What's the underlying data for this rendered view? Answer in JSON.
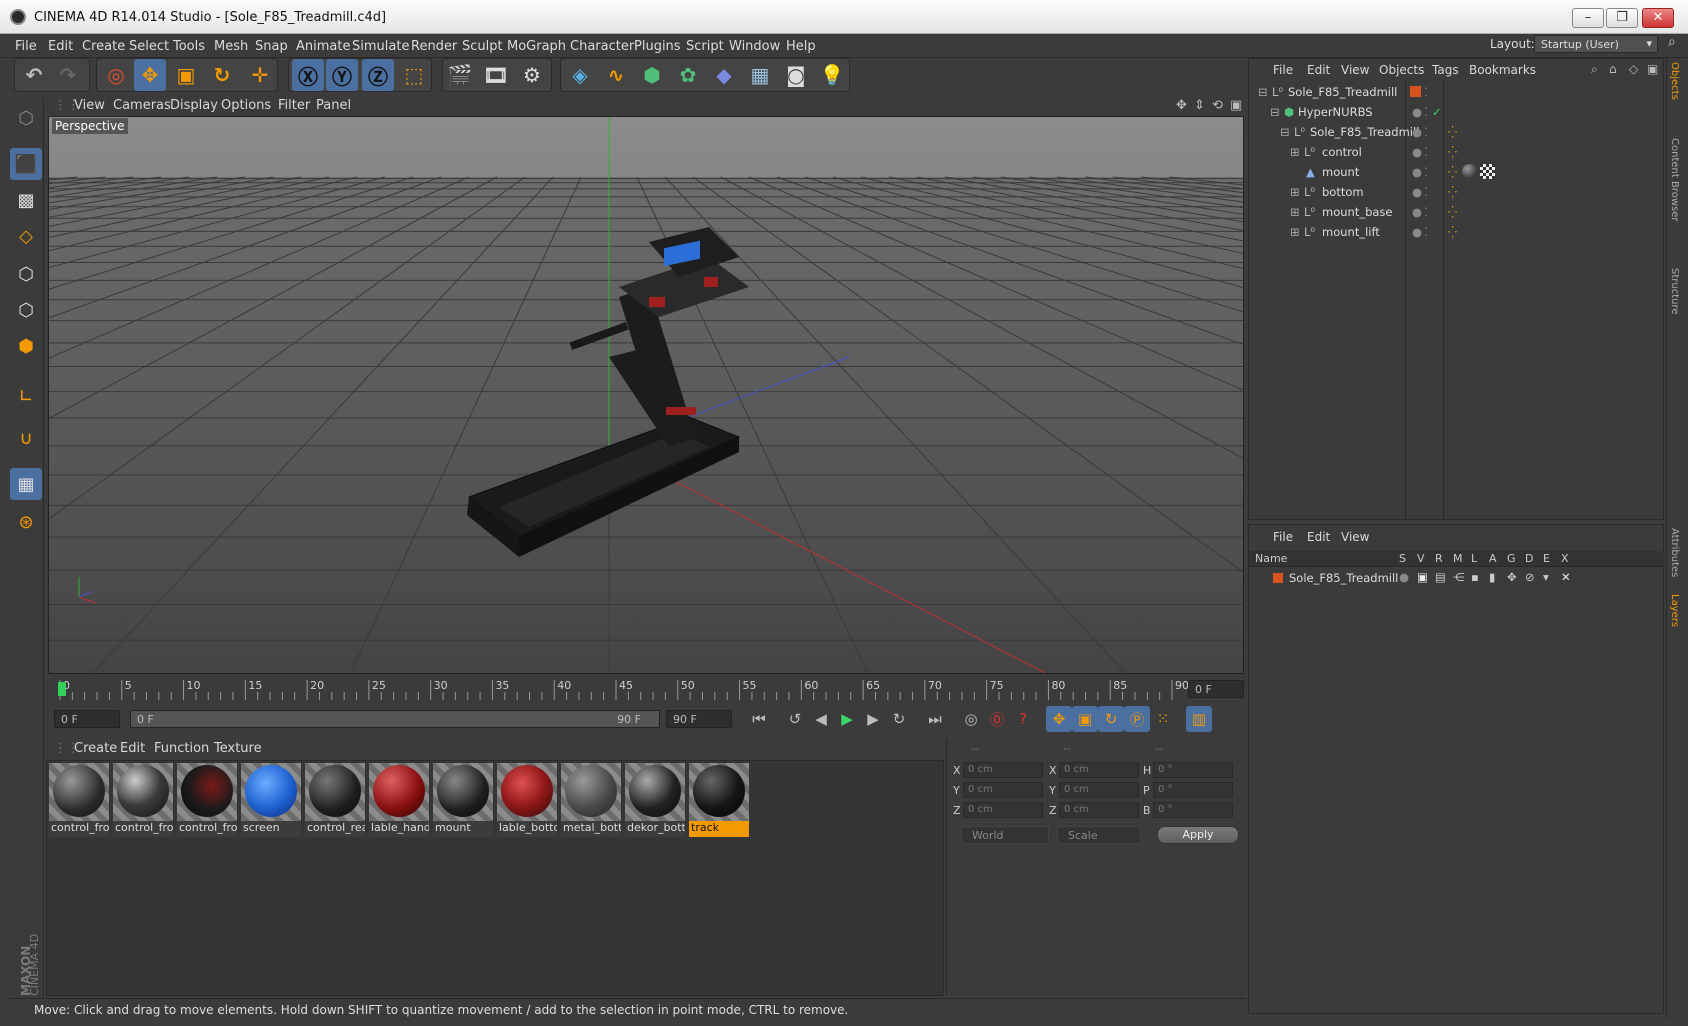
{
  "window": {
    "title": "CINEMA 4D R14.014 Studio - [Sole_F85_Treadmill.c4d]",
    "min": "–",
    "max": "❐",
    "close": "✕"
  },
  "menu": [
    "File",
    "Edit",
    "Create",
    "Select",
    "Tools",
    "Mesh",
    "Snap",
    "Animate",
    "Simulate",
    "Render",
    "Sculpt",
    "MoGraph",
    "Character",
    "Plugins",
    "Script",
    "Window",
    "Help"
  ],
  "layout": {
    "label": "Layout:",
    "value": "Startup (User)"
  },
  "viewport": {
    "menu": [
      "View",
      "Cameras",
      "Display",
      "Options",
      "Filter",
      "Panel"
    ],
    "label": "Perspective"
  },
  "timeline": {
    "ticks": [
      "0",
      "5",
      "10",
      "15",
      "20",
      "25",
      "30",
      "35",
      "40",
      "45",
      "50",
      "55",
      "60",
      "65",
      "70",
      "75",
      "80",
      "85",
      "90"
    ],
    "frame_right": "0 F",
    "start": "0 F",
    "range_start": "0 F",
    "range_end": "90 F",
    "end": "90 F"
  },
  "materials": {
    "menu": [
      "Create",
      "Edit",
      "Function",
      "Texture"
    ],
    "items": [
      "control_fro",
      "control_fro",
      "control_fro",
      "screen",
      "control_rea",
      "lable_hand",
      "mount",
      "lable_botto",
      "metal_bott",
      "dekor_bott",
      "track"
    ]
  },
  "coords": {
    "headers": [
      "--",
      "--",
      "--"
    ],
    "rows": [
      {
        "a": "X",
        "av": "0 cm",
        "b": "X",
        "bv": "0 cm",
        "c": "H",
        "cv": "0 °"
      },
      {
        "a": "Y",
        "av": "0 cm",
        "b": "Y",
        "bv": "0 cm",
        "c": "P",
        "cv": "0 °"
      },
      {
        "a": "Z",
        "av": "0 cm",
        "b": "Z",
        "bv": "0 cm",
        "c": "B",
        "cv": "0 °"
      }
    ],
    "space": "World",
    "mode": "Scale",
    "apply": "Apply"
  },
  "status": "Move: Click and drag to move elements. Hold down SHIFT to quantize movement / add to the selection in point mode, CTRL to remove.",
  "objects": {
    "menu": [
      "File",
      "Edit",
      "View",
      "Objects",
      "Tags",
      "Bookmarks"
    ],
    "tree": [
      {
        "name": "Sole_F85_Treadmill",
        "depth": 0
      },
      {
        "name": "HyperNURBS",
        "depth": 1
      },
      {
        "name": "Sole_F85_Treadmill",
        "depth": 2
      },
      {
        "name": "control",
        "depth": 3
      },
      {
        "name": "mount",
        "depth": 3
      },
      {
        "name": "bottom",
        "depth": 3
      },
      {
        "name": "mount_base",
        "depth": 3
      },
      {
        "name": "mount_lift",
        "depth": 3
      }
    ]
  },
  "layers": {
    "menu": [
      "File",
      "Edit",
      "View"
    ],
    "columns": [
      "Name",
      "S",
      "V",
      "R",
      "M",
      "L",
      "A",
      "G",
      "D",
      "E",
      "X"
    ],
    "rows": [
      "Sole_F85_Treadmill"
    ]
  },
  "side_tabs": [
    "Objects",
    "Content Browser",
    "Structure",
    "Attributes",
    "Layers"
  ],
  "brand": {
    "line1": "MAXON",
    "line2": "CINEMA 4D"
  },
  "colors": {
    "accent": "#f29a00",
    "selection": "#4b6fa0",
    "x_axis": "#c03030",
    "y_axis": "#30b030",
    "z_axis": "#4050d0"
  }
}
